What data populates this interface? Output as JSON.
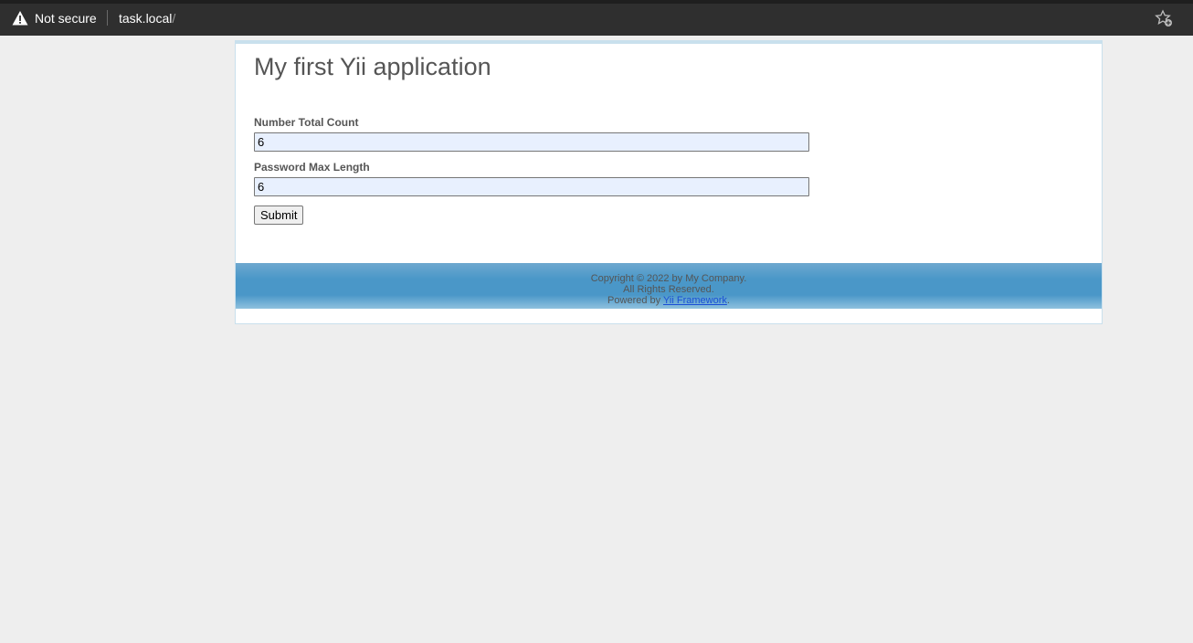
{
  "browser": {
    "security_label": "Not secure",
    "url_host": "task.local",
    "url_path": "/",
    "bookmark_icon": "star-add-icon"
  },
  "page": {
    "title": "My first Yii application",
    "form": {
      "fields": [
        {
          "label": "Number Total Count",
          "value": "6"
        },
        {
          "label": "Password Max Length",
          "value": "6"
        }
      ],
      "submit_label": "Submit"
    },
    "footer": {
      "copyright": "Copyright © 2022 by My Company.",
      "rights": "All Rights Reserved.",
      "powered_prefix": "Powered by ",
      "powered_link": "Yii Framework",
      "powered_suffix": "."
    }
  },
  "colors": {
    "page_background": "#eeeeee",
    "footer_blue": "#4a97c8",
    "input_background": "#e8f0fe"
  }
}
